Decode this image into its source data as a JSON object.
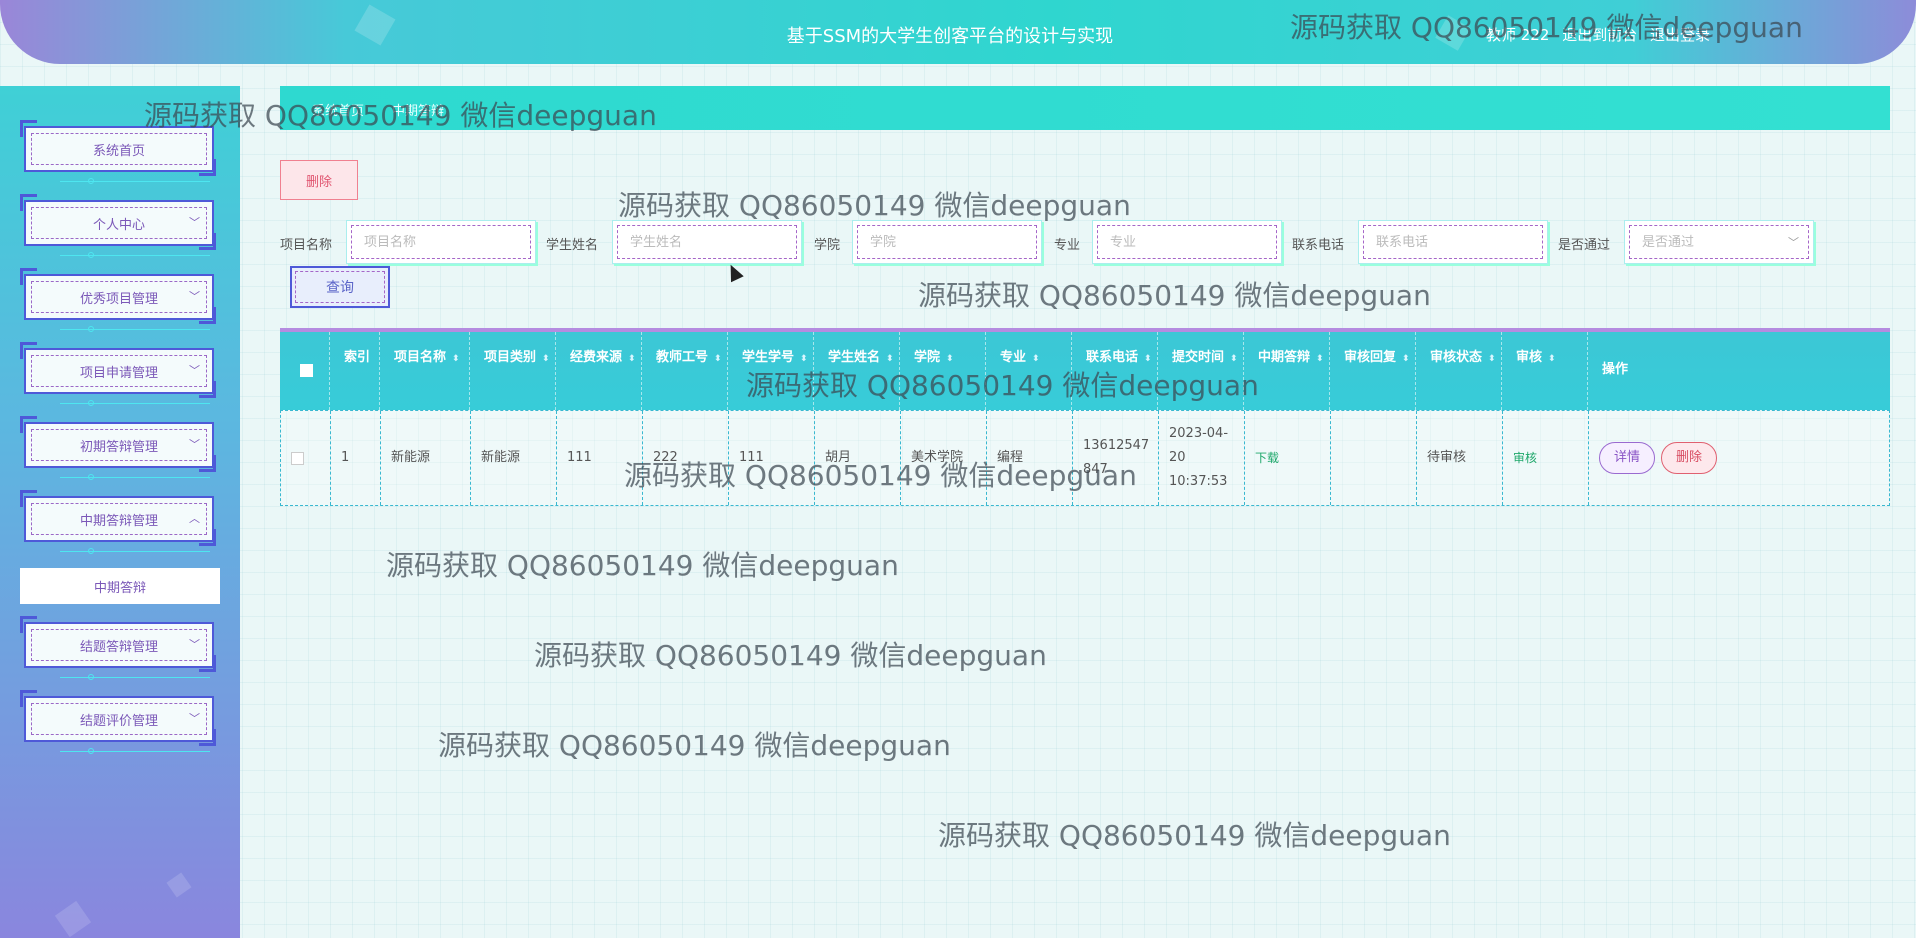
{
  "app": {
    "title": "基于SSM的大学生创客平台的设计与实现",
    "user": {
      "role_name": "教师 222",
      "back_link": "退出到前台",
      "logout_link": "退出登录"
    }
  },
  "breadcrumb": [
    "系统首页",
    "中期答辩"
  ],
  "sidebar": {
    "items": [
      {
        "label": "系统首页",
        "expandable": false
      },
      {
        "label": "个人中心",
        "expandable": true
      },
      {
        "label": "优秀项目管理",
        "expandable": true
      },
      {
        "label": "项目申请管理",
        "expandable": true
      },
      {
        "label": "初期答辩管理",
        "expandable": true
      },
      {
        "label": "中期答辩管理",
        "expandable": true,
        "expanded": true
      },
      {
        "label": "结题答辩管理",
        "expandable": true
      },
      {
        "label": "结题评价管理",
        "expandable": true
      }
    ],
    "submenu_item": "中期答辩"
  },
  "toolbar": {
    "delete_label": "删除",
    "query_label": "查询"
  },
  "search": {
    "fields": [
      {
        "label": "项目名称",
        "placeholder": "项目名称"
      },
      {
        "label": "学生姓名",
        "placeholder": "学生姓名"
      },
      {
        "label": "学院",
        "placeholder": "学院"
      },
      {
        "label": "专业",
        "placeholder": "专业"
      },
      {
        "label": "联系电话",
        "placeholder": "联系电话"
      },
      {
        "label": "是否通过",
        "placeholder": "是否通过",
        "select": true
      }
    ]
  },
  "table": {
    "headers": [
      "索引",
      "项目名称",
      "项目类别",
      "经费来源",
      "教师工号",
      "学生学号",
      "学生姓名",
      "学院",
      "专业",
      "联系电话",
      "提交时间",
      "中期答辩",
      "审核回复",
      "审核状态",
      "审核",
      "操作"
    ],
    "rows": [
      {
        "index": "1",
        "project_name": "新能源",
        "project_type": "新能源",
        "funding": "111",
        "teacher_id": "222",
        "student_id": "111",
        "student_name": "胡月",
        "college": "美术学院",
        "major": "编程",
        "phone": "13612547847",
        "submit_time": "2023-04-20 10:37:53",
        "defense_file": "下载",
        "review_reply": "",
        "review_status": "待审核",
        "review_action": "审核",
        "ops": {
          "detail": "详情",
          "delete": "删除"
        }
      }
    ]
  },
  "watermark": "源码获取 QQ86050149 微信deepguan",
  "colors": {
    "accent": "#2ed9d0",
    "sidebar_border": "#4e59d8",
    "link_green": "#1fa86b",
    "danger": "#e05570"
  }
}
